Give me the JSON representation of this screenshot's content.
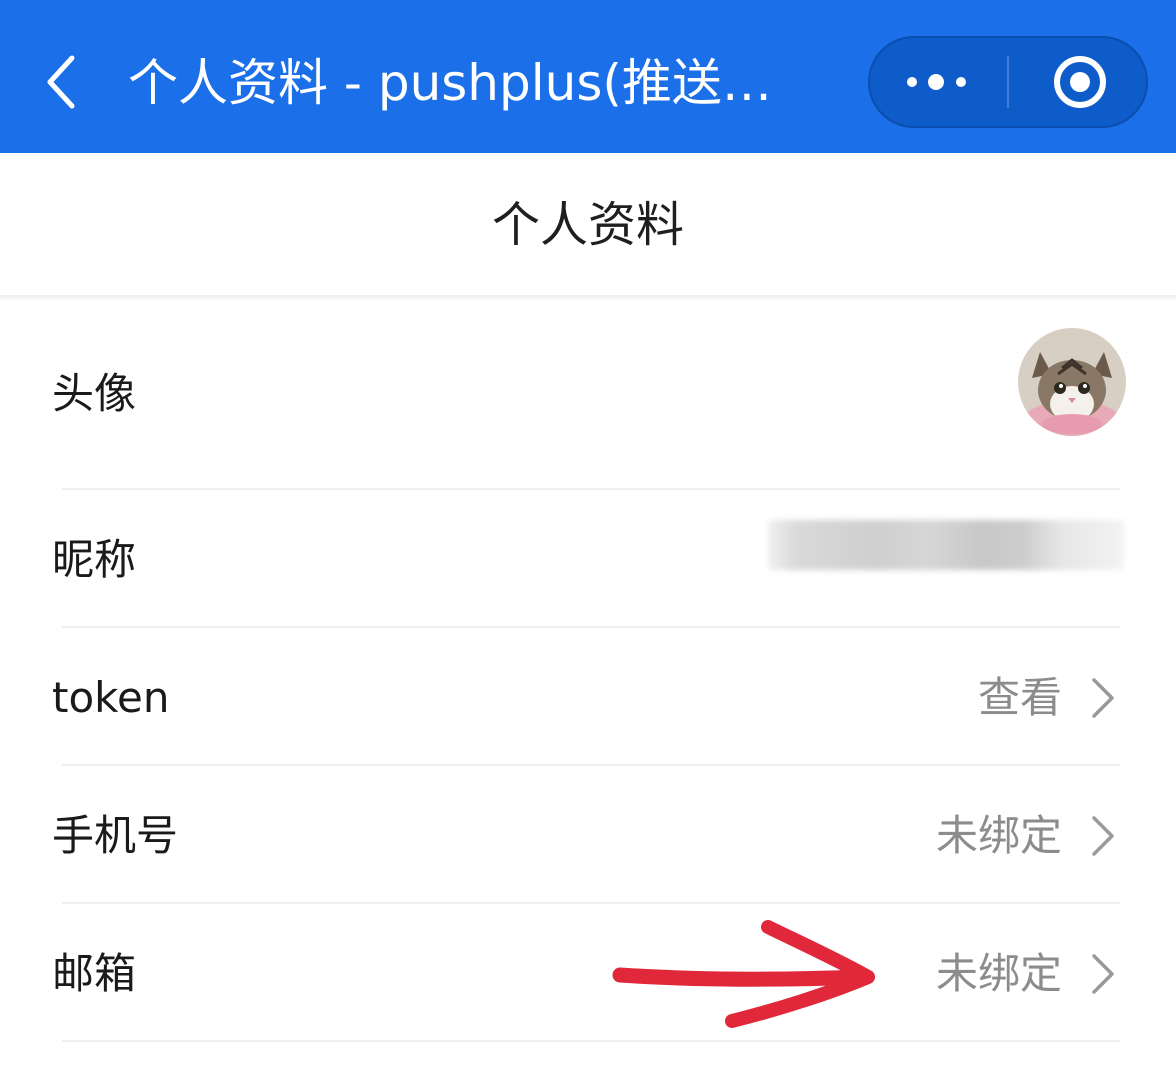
{
  "navbar": {
    "back_icon": "chevron-left-icon",
    "title": "个人资料 - pushplus(推送…",
    "more_icon": "more-dots-icon",
    "close_icon": "target-circle-icon",
    "background": "#1b6fe8"
  },
  "header": {
    "title": "个人资料"
  },
  "rows": [
    {
      "label": "头像",
      "value_type": "avatar-image"
    },
    {
      "label": "昵称",
      "value_type": "blurred-text"
    },
    {
      "label": "token",
      "value": "查看",
      "chevron_icon": "chevron-right-icon"
    },
    {
      "label": "手机号",
      "value": "未绑定",
      "chevron_icon": "chevron-right-icon"
    },
    {
      "label": "邮箱",
      "value": "未绑定",
      "chevron_icon": "chevron-right-icon"
    }
  ],
  "annotation": {
    "arrow_icon": "red-hand-drawn-arrow-icon",
    "color": "#e0283a"
  }
}
